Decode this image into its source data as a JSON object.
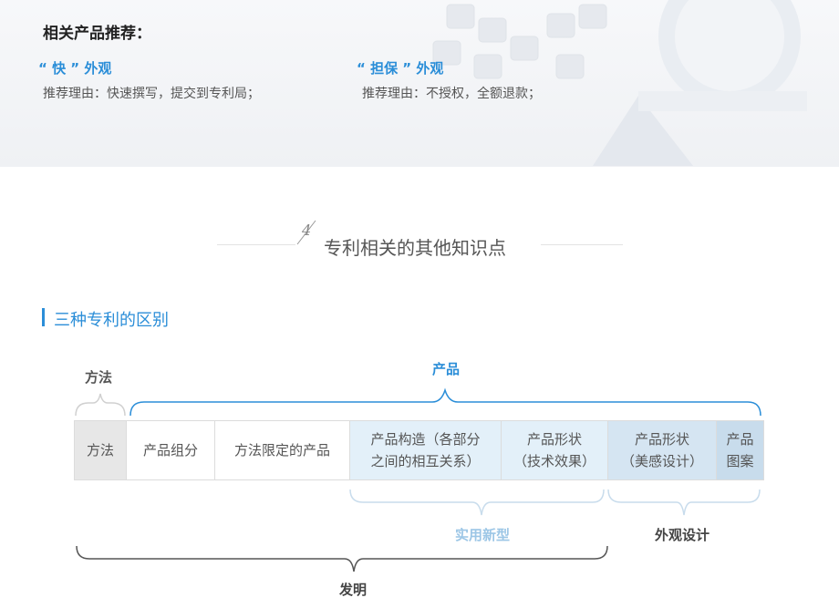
{
  "recommend": {
    "title": "相关产品推荐：",
    "items": [
      {
        "title": "“ 快 ” 外观",
        "reason": "推荐理由：快速撰写，提交到专利局；"
      },
      {
        "title": "“ 担保 ” 外观",
        "reason": "推荐理由：不授权，全额退款；"
      }
    ]
  },
  "section": {
    "number": "4",
    "title": "专利相关的其他知识点"
  },
  "subsection": {
    "title": "三种专利的区别"
  },
  "diagram": {
    "labels": {
      "method": "方法",
      "product": "产品",
      "utility": "实用新型",
      "design": "外观设计",
      "invention": "发明"
    },
    "cells": [
      {
        "lines": [
          "方法"
        ]
      },
      {
        "lines": [
          "产品组分"
        ]
      },
      {
        "lines": [
          "方法限定的产品"
        ]
      },
      {
        "lines": [
          "产品构造（各部分",
          "之间的相互关系）"
        ]
      },
      {
        "lines": [
          "产品形状",
          "（技术效果）"
        ]
      },
      {
        "lines": [
          "产品形状",
          "（美感设计）"
        ]
      },
      {
        "lines": [
          "产品",
          "图案"
        ]
      }
    ]
  },
  "colors": {
    "accent": "#2b8ed8",
    "light_blue": "#9cc6e6",
    "brace_gray": "#555555"
  }
}
